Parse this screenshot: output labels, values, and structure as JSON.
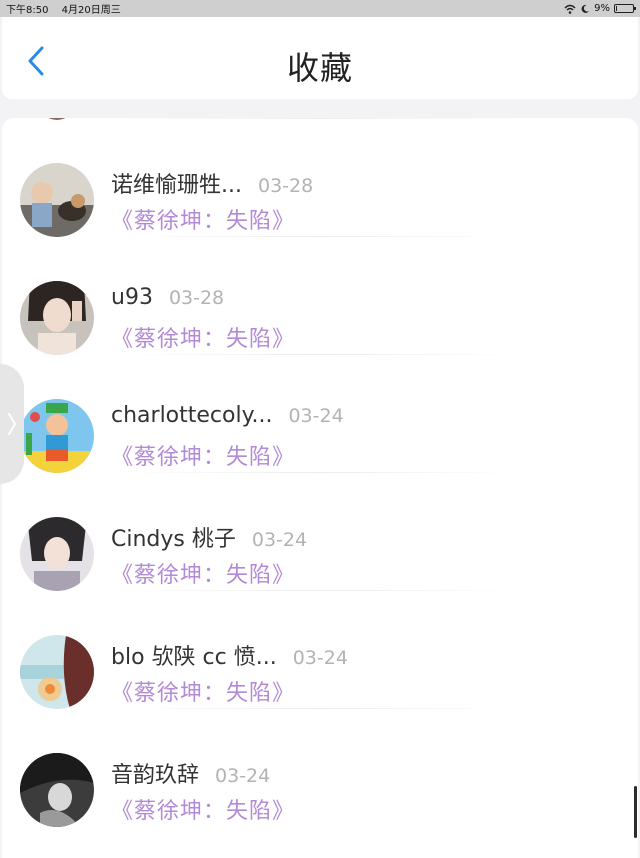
{
  "status_bar": {
    "time": "下午8:50",
    "date": "4月20日周三",
    "battery_text": "9%",
    "battery_level": 0.09,
    "icons": [
      "wifi-icon",
      "moon-icon",
      "battery-icon"
    ]
  },
  "nav": {
    "title": "收藏",
    "back_icon": "chevron-left-icon",
    "accent_color": "#2a8be6"
  },
  "colors": {
    "song_title": "#b38ad6",
    "date": "#b3b3b3"
  },
  "items": [
    {
      "name": "诺维愉珊牲...",
      "date": "03-28",
      "song": "《蔡徐坤：失陷》",
      "avatar": "avatar-photo-child-dog"
    },
    {
      "name": "u93",
      "date": "03-28",
      "song": "《蔡徐坤：失陷》",
      "avatar": "avatar-photo-woman"
    },
    {
      "name": "charlottecoly...",
      "date": "03-24",
      "song": "《蔡徐坤：失陷》",
      "avatar": "avatar-cartoon"
    },
    {
      "name": "Cindys 桃子",
      "date": "03-24",
      "song": "《蔡徐坤：失陷》",
      "avatar": "avatar-photo-woman"
    },
    {
      "name": "blo 欤陕 cc 愤...",
      "date": "03-24",
      "song": "《蔡徐坤：失陷》",
      "avatar": "avatar-photo-beach"
    },
    {
      "name": "音韵玖辞",
      "date": "03-24",
      "song": "《蔡徐坤：失陷》",
      "avatar": "avatar-photo-bw"
    }
  ]
}
